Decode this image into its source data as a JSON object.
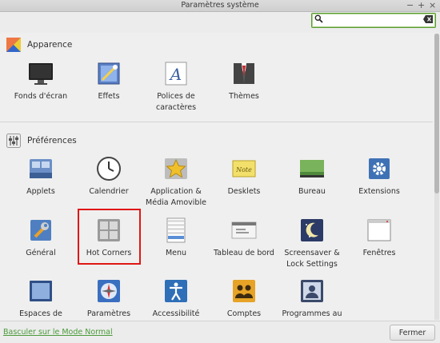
{
  "window": {
    "title": "Paramètres système",
    "controls": {
      "minimize": "−",
      "maximize": "+",
      "close": "×"
    }
  },
  "search": {
    "value": "",
    "placeholder": ""
  },
  "sections": {
    "appearance": {
      "title": "Apparence",
      "items": [
        {
          "label": "Fonds d'écran",
          "icon": "monitor-icon"
        },
        {
          "label": "Effets",
          "icon": "effects-icon"
        },
        {
          "label": "Polices de caractères",
          "icon": "font-icon"
        },
        {
          "label": "Thèmes",
          "icon": "theme-suit-icon"
        }
      ]
    },
    "preferences": {
      "title": "Préférences",
      "items": [
        {
          "label": "Applets",
          "icon": "applets-icon"
        },
        {
          "label": "Calendrier",
          "icon": "clock-icon"
        },
        {
          "label": "Application & Média Amovible",
          "icon": "media-star-icon"
        },
        {
          "label": "Desklets",
          "icon": "desklets-note-icon"
        },
        {
          "label": "Bureau",
          "icon": "desktop-icon"
        },
        {
          "label": "Extensions",
          "icon": "extensions-gear-icon"
        },
        {
          "label": "Général",
          "icon": "wrench-icon"
        },
        {
          "label": "Hot Corners",
          "icon": "hot-corners-icon"
        },
        {
          "label": "Menu",
          "icon": "menu-icon"
        },
        {
          "label": "Tableau de bord",
          "icon": "panel-icon"
        },
        {
          "label": "Screensaver & Lock Settings",
          "icon": "screensaver-moon-icon"
        },
        {
          "label": "Fenêtres",
          "icon": "window-icon"
        },
        {
          "label": "Espaces de",
          "icon": "workspaces-icon"
        },
        {
          "label": "Paramètres",
          "icon": "settings-compass-icon"
        },
        {
          "label": "Accessibilité",
          "icon": "accessibility-icon"
        },
        {
          "label": "Comptes",
          "icon": "accounts-icon"
        },
        {
          "label": "Programmes au",
          "icon": "startup-programs-icon"
        }
      ]
    }
  },
  "footer": {
    "toggle_link": "Basculer sur le Mode Normal",
    "close_button": "Fermer"
  }
}
